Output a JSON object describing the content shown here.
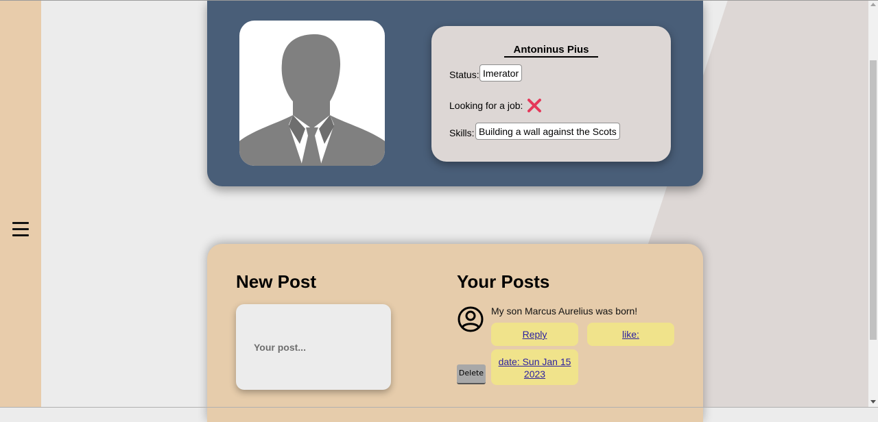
{
  "sidebar": {
    "menu_icon": "hamburger-icon"
  },
  "profile": {
    "avatar_icon": "person-silhouette-avatar",
    "name": "Antoninus Pius",
    "status_label": "Status:",
    "status_value": "Imerator",
    "job_label": "Looking for a job:",
    "job_icon": "cross-icon",
    "job_color": "#e5385a",
    "skills_label": "Skills:",
    "skills_value": "Building a wall against the Scots"
  },
  "new_post": {
    "heading": "New Post",
    "placeholder": "Your post..."
  },
  "your_posts": {
    "heading": "Your Posts",
    "posts": [
      {
        "avatar_icon": "user-circle-icon",
        "text": "My son Marcus Aurelius was born!",
        "reply_label": "Reply",
        "like_label": "like:",
        "date_label": "date: Sun Jan 15 2023",
        "delete_label": "Delete"
      }
    ]
  },
  "colors": {
    "sidebar": "#e8ccab",
    "profile_card": "#495e78",
    "info_card": "#ddd7d5",
    "posts_card": "#e6ccab",
    "action_button": "#f0e38b"
  }
}
